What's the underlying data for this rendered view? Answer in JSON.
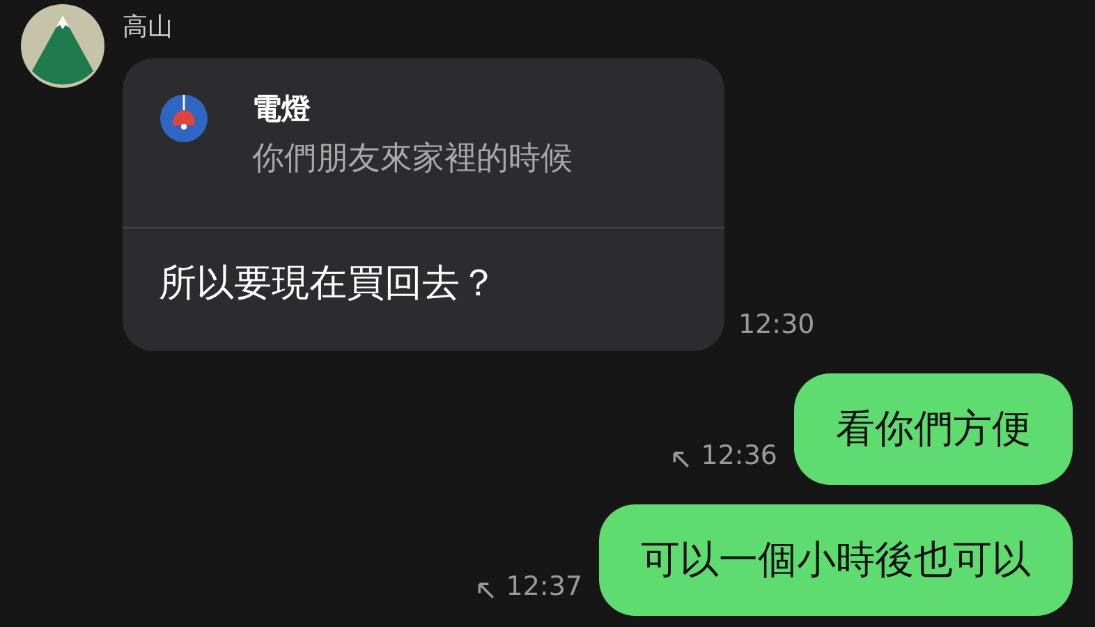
{
  "sender": {
    "name": "高山"
  },
  "messages": [
    {
      "kind": "incoming",
      "quote": {
        "title": "電燈",
        "text": "你們朋友來家裡的時候"
      },
      "text": "所以要現在買回去？",
      "time": "12:30"
    },
    {
      "kind": "outgoing",
      "text": "看你們方便",
      "time": "12:36"
    },
    {
      "kind": "outgoing",
      "text": "可以一個小時後也可以",
      "time": "12:37"
    }
  ]
}
